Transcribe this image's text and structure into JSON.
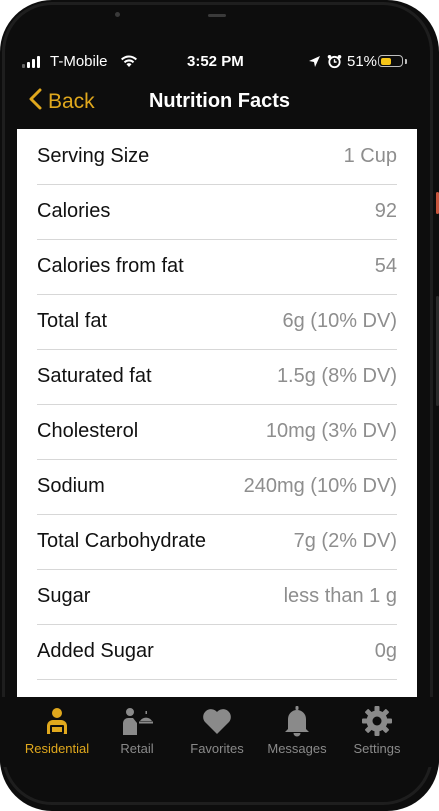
{
  "status_bar": {
    "carrier": "T-Mobile",
    "time": "3:52 PM",
    "battery_percent": "51%",
    "battery_level": 0.51
  },
  "nav": {
    "back_label": "Back",
    "title": "Nutrition Facts"
  },
  "nutrition": {
    "rows": [
      {
        "label": "Serving Size",
        "value": "1 Cup"
      },
      {
        "label": "Calories",
        "value": "92"
      },
      {
        "label": "Calories from fat",
        "value": "54"
      },
      {
        "label": "Total fat",
        "value": "6g (10% DV)"
      },
      {
        "label": "Saturated fat",
        "value": "1.5g (8% DV)"
      },
      {
        "label": "Cholesterol",
        "value": "10mg (3% DV)"
      },
      {
        "label": "Sodium",
        "value": "240mg (10% DV)"
      },
      {
        "label": "Total Carbohydrate",
        "value": "7g (2% DV)"
      },
      {
        "label": "Sugar",
        "value": "less than 1 g"
      },
      {
        "label": "Added Sugar",
        "value": "0g"
      }
    ]
  },
  "tabs": [
    {
      "label": "Residential",
      "icon": "residential-icon",
      "active": true
    },
    {
      "label": "Retail",
      "icon": "retail-icon",
      "active": false
    },
    {
      "label": "Favorites",
      "icon": "heart-icon",
      "active": false
    },
    {
      "label": "Messages",
      "icon": "bell-icon",
      "active": false
    },
    {
      "label": "Settings",
      "icon": "gear-icon",
      "active": false
    }
  ],
  "colors": {
    "accent": "#e0a81d",
    "background": "#0d0d0d",
    "card": "#ffffff",
    "value_text": "#8e8e8e",
    "inactive_tab": "#8a8a8a"
  }
}
